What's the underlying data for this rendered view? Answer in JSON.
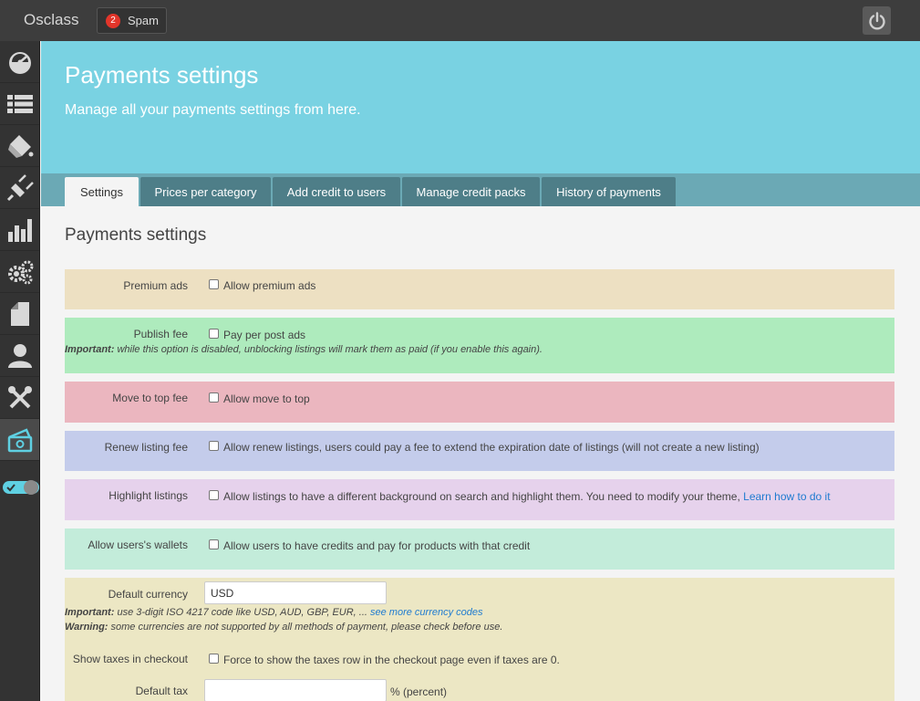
{
  "topbar": {
    "brand": "Osclass",
    "spam": {
      "count": "2",
      "label": "Spam"
    }
  },
  "sidebar": {
    "icons": [
      "dashboard-icon",
      "listings-icon",
      "appearance-icon",
      "plugins-icon",
      "stats-icon",
      "settings-icon",
      "pages-icon",
      "users-icon",
      "tools-icon",
      "payments-icon"
    ],
    "active_index": 9
  },
  "hero": {
    "title": "Payments settings",
    "subtitle": "Manage all your payments settings from here."
  },
  "tabs": [
    {
      "label": "Settings",
      "active": true
    },
    {
      "label": "Prices per category",
      "active": false
    },
    {
      "label": "Add credit to users",
      "active": false
    },
    {
      "label": "Manage credit packs",
      "active": false
    },
    {
      "label": "History of payments",
      "active": false
    }
  ],
  "section_title": "Payments settings",
  "rows": {
    "premium": {
      "label": "Premium ads",
      "option": "Allow premium ads",
      "color": "#ede0c2"
    },
    "publish": {
      "label": "Publish fee",
      "option": "Pay per post ads",
      "note_strong": "Important:",
      "note": " while this option is disabled, unblocking listings will mark them as paid (if you enable this again).",
      "color": "#aeebbd"
    },
    "move_top": {
      "label": "Move to top fee",
      "option": "Allow move to top",
      "color": "#ebb6bf"
    },
    "renew": {
      "label": "Renew listing fee",
      "option": "Allow renew listings, users could pay a fee to extend the expiration date of listings (will not create a new listing)",
      "color": "#c4cceb"
    },
    "highlight": {
      "label": "Highlight listings",
      "option": "Allow listings to have a different background on search and highlight them. You need to modify your theme,",
      "link": "Learn how to do it",
      "color": "#e6d2ec"
    },
    "wallets": {
      "label": "Allow users's wallets",
      "option": "Allow users to have credits and pay for products with that credit",
      "color": "#c3ecda"
    },
    "currency": {
      "label": "Default currency",
      "value": "USD",
      "note1_strong": "Important:",
      "note1": " use 3-digit ISO 4217 code like USD, AUD, GBP, EUR, ...",
      "note1_link": "see more currency codes",
      "note2_strong": "Warning:",
      "note2": " some currencies are not supported by all methods of payment, please check before use.",
      "color": "#ece7c4"
    },
    "taxes": {
      "label": "Show taxes in checkout",
      "option": "Force to show the taxes row in the checkout page even if taxes are 0."
    },
    "default_tax": {
      "label": "Default tax",
      "value": "",
      "suffix": "% (percent)"
    }
  }
}
